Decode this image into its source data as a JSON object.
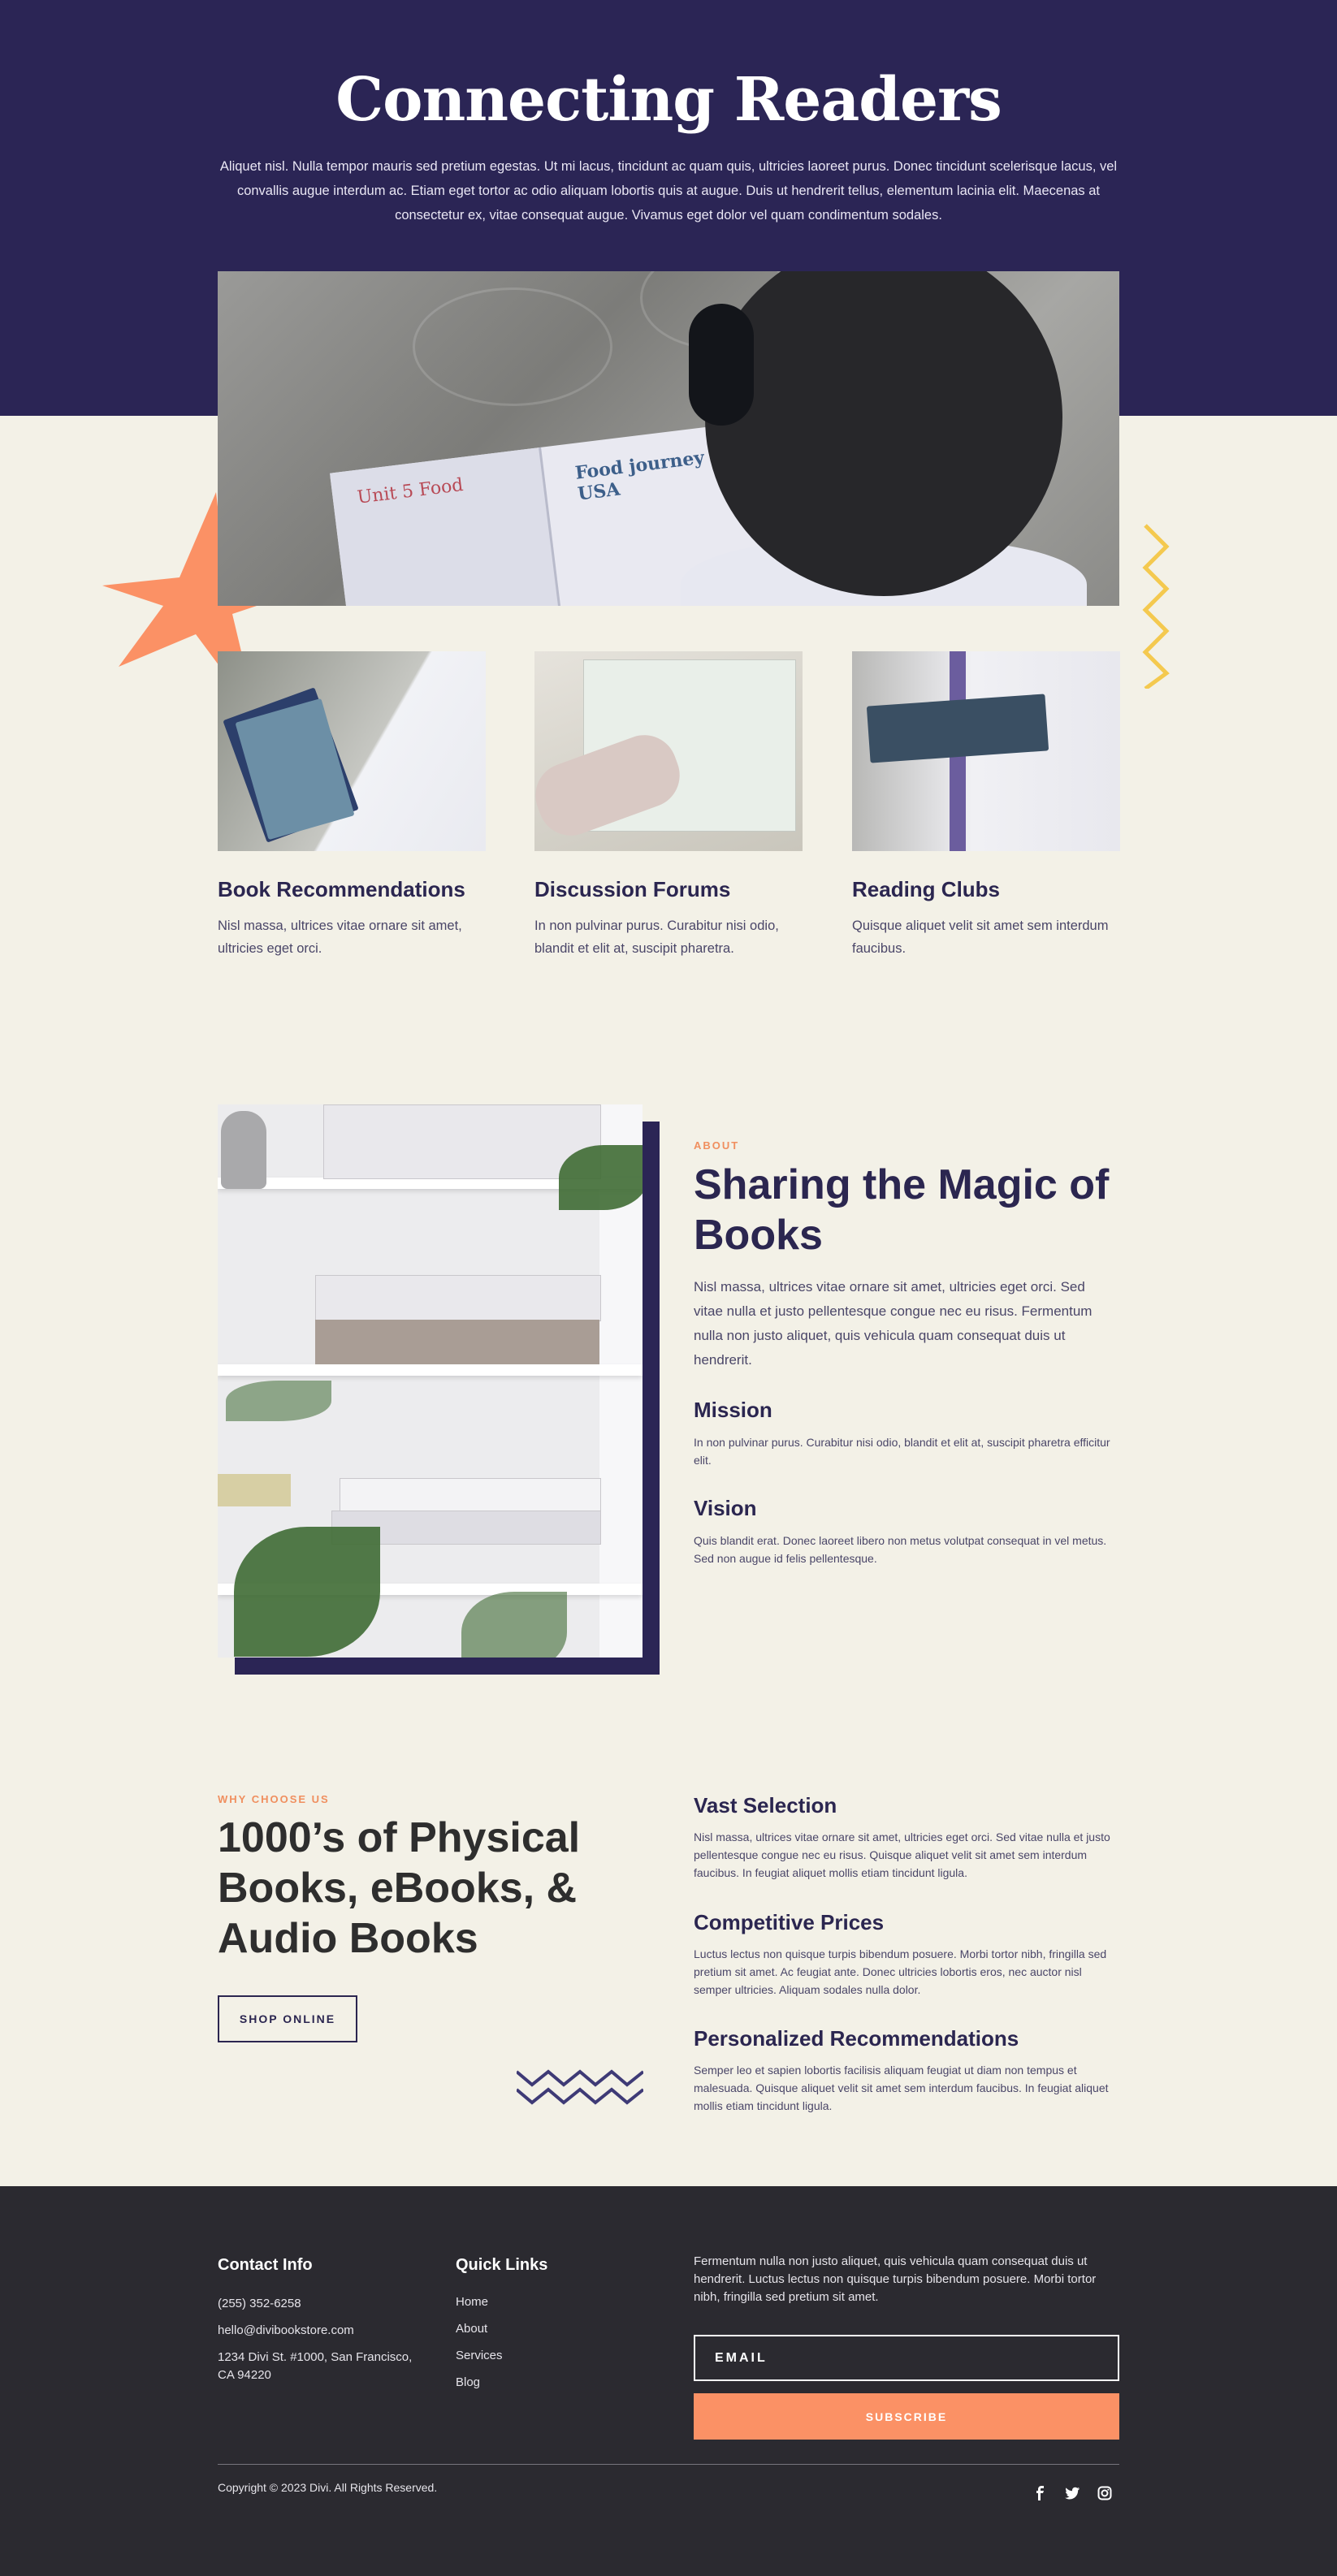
{
  "hero": {
    "title": "Connecting Readers",
    "text": "Aliquet nisl. Nulla tempor mauris sed pretium egestas. Ut mi lacus, tincidunt ac quam quis, ultricies laoreet purus. Donec tincidunt scelerisque lacus, vel convallis augue interdum ac. Etiam eget tortor ac odio aliquam lobortis quis at augue. Duis ut hendrerit tellus, elementum lacinia elit. Maecenas at consectetur ex, vitae consequat augue. Vivamus eget dolor vel quam condimentum sodales.",
    "book_left_text": "Unit 5 Food",
    "book_right_text": "Food journey in the USA"
  },
  "features": [
    {
      "title": "Book Recommendations",
      "text": "Nisl massa, ultrices vitae ornare sit amet, ultricies eget orci."
    },
    {
      "title": "Discussion Forums",
      "text": "In non pulvinar purus. Curabitur nisi odio, blandit et elit at, suscipit pharetra."
    },
    {
      "title": "Reading Clubs",
      "text": "Quisque aliquet velit sit amet sem interdum faucibus."
    }
  ],
  "about": {
    "eyebrow": "ABOUT",
    "title": "Sharing the Magic of Books",
    "text": "Nisl massa, ultrices vitae ornare sit amet, ultricies eget orci. Sed vitae nulla et justo pellentesque congue nec eu risus. Fermentum nulla non justo aliquet, quis vehicula quam consequat duis ut hendrerit.",
    "mission_title": "Mission",
    "mission_text": "In non pulvinar purus. Curabitur nisi odio, blandit et elit at, suscipit pharetra efficitur elit.",
    "vision_title": "Vision",
    "vision_text": "Quis blandit erat. Donec laoreet libero non metus volutpat consequat in vel metus. Sed non augue id felis pellentesque."
  },
  "why": {
    "eyebrow": "WHY CHOOSE US",
    "title": "1000’s of Physical Books, eBooks, & Audio Books",
    "button": "SHOP ONLINE",
    "items": [
      {
        "title": "Vast Selection",
        "text": "Nisl massa, ultrices vitae ornare sit amet, ultricies eget orci. Sed vitae nulla et justo pellentesque congue nec eu risus. Quisque aliquet velit sit amet sem interdum faucibus. In feugiat aliquet mollis etiam tincidunt ligula."
      },
      {
        "title": "Competitive Prices",
        "text": "Luctus lectus non quisque turpis bibendum posuere. Morbi tortor nibh, fringilla sed pretium sit amet. Ac feugiat ante. Donec ultricies lobortis eros, nec auctor nisl semper ultricies. Aliquam sodales nulla dolor."
      },
      {
        "title": "Personalized Recommendations",
        "text": "Semper leo et sapien lobortis facilisis aliquam feugiat ut diam non tempus et malesuada. Quisque aliquet velit sit amet sem interdum faucibus. In feugiat aliquet mollis etiam tincidunt ligula."
      }
    ]
  },
  "footer": {
    "contact_title": "Contact Info",
    "phone": "(255) 352-6258",
    "email": "hello@divibookstore.com",
    "address": "1234 Divi St. #1000, San Francisco, CA 94220",
    "links_title": "Quick Links",
    "links": [
      "Home",
      "About",
      "Services",
      "Blog"
    ],
    "newsletter_text": "Fermentum nulla non justo aliquet, quis vehicula quam consequat duis ut hendrerit. Luctus lectus non quisque turpis bibendum posuere. Morbi tortor nibh, fringilla sed pretium sit amet.",
    "email_placeholder": "EMAIL",
    "subscribe_label": "SUBSCRIBE",
    "copyright": "Copyright © 2023 Divi. All Rights Reserved.",
    "social": [
      "facebook-icon",
      "twitter-icon",
      "instagram-icon"
    ]
  },
  "colors": {
    "navy": "#2b2555",
    "cream": "#f3f1e7",
    "orange": "#fb9165",
    "yellow": "#f4c94f",
    "footer": "#2b2a30"
  }
}
